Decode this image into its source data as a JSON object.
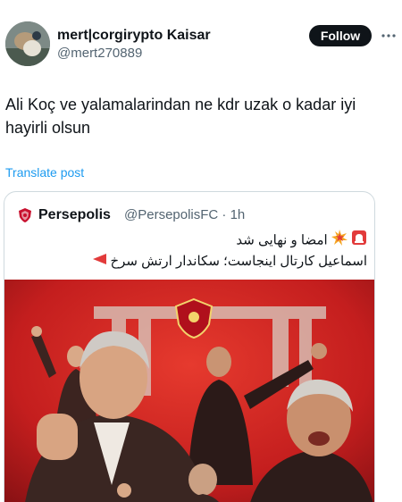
{
  "tweet": {
    "display_name": "mert|corgirypto Kaisar",
    "handle": "@mert270889",
    "follow_label": "Follow",
    "text": "Ali Koç ve yalamalarindan ne kdr uzak o kadar iyi hayirli olsun",
    "translate_label": "Translate post"
  },
  "quoted": {
    "name": "Persepolis",
    "handle_time": "@PersepolisFC · 1h",
    "line1": "امضا و نهایی شد",
    "line2": "اسماعیل کارتال اینجاست؛ سکاندار ارتش سرخ"
  },
  "icons": {
    "more": "more-horizontal-icon",
    "siren": "siren-emoji-icon",
    "collision": "collision-emoji-icon",
    "pointer": "red-triangle-pointing-left-icon"
  },
  "colors": {
    "follow_bg": "#0f1419",
    "link": "#1d9bf0",
    "brand_red": "#c8102e"
  }
}
